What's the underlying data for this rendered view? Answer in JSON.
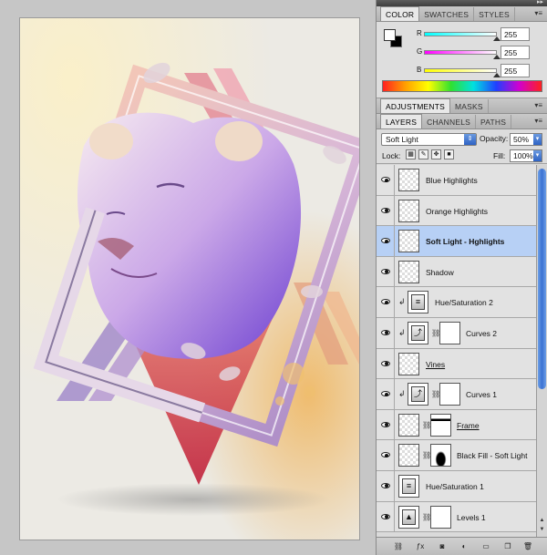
{
  "color_panel": {
    "tabs": [
      "COLOR",
      "SWATCHES",
      "STYLES"
    ],
    "active_tab": "COLOR",
    "channels": [
      {
        "label": "R",
        "value": "255"
      },
      {
        "label": "G",
        "value": "255"
      },
      {
        "label": "B",
        "value": "255"
      }
    ],
    "foreground_color": "#ffffff",
    "background_color": "#000000"
  },
  "adjustments_panel": {
    "tabs": [
      "ADJUSTMENTS",
      "MASKS"
    ]
  },
  "layers_panel": {
    "tabs": [
      "LAYERS",
      "CHANNELS",
      "PATHS"
    ],
    "blend_mode": "Soft Light",
    "opacity_label": "Opacity:",
    "opacity": "50%",
    "lock_label": "Lock:",
    "fill_label": "Fill:",
    "fill": "100%",
    "layers": [
      {
        "name": "Blue Highlights",
        "type": "pixel",
        "thumb": "blue",
        "visible": true,
        "selected": false,
        "clipped": false,
        "mask": false,
        "style": ""
      },
      {
        "name": "Orange Highlights",
        "type": "pixel",
        "thumb": "orange",
        "visible": true,
        "selected": false,
        "clipped": false,
        "mask": false,
        "style": ""
      },
      {
        "name": "Soft Light - Hghlights",
        "type": "pixel",
        "thumb": "empty",
        "visible": true,
        "selected": true,
        "clipped": false,
        "mask": false,
        "style": "bold"
      },
      {
        "name": "Shadow",
        "type": "pixel",
        "thumb": "empty",
        "visible": true,
        "selected": false,
        "clipped": false,
        "mask": false,
        "style": ""
      },
      {
        "name": "Hue/Saturation 2",
        "type": "adjustment",
        "thumb": "huesat",
        "visible": true,
        "selected": false,
        "clipped": true,
        "mask": false,
        "style": ""
      },
      {
        "name": "Curves 2",
        "type": "adjustment",
        "thumb": "curves",
        "visible": true,
        "selected": false,
        "clipped": true,
        "mask": true,
        "style": ""
      },
      {
        "name": "Vines",
        "type": "pixel",
        "thumb": "vines",
        "visible": true,
        "selected": false,
        "clipped": false,
        "mask": false,
        "style": "underline"
      },
      {
        "name": "Curves 1",
        "type": "adjustment",
        "thumb": "curves",
        "visible": true,
        "selected": false,
        "clipped": true,
        "mask": true,
        "style": ""
      },
      {
        "name": "Frame",
        "type": "pixel",
        "thumb": "frame",
        "visible": true,
        "selected": false,
        "clipped": false,
        "mask": true,
        "style": "underline"
      },
      {
        "name": "Black Fill - Soft Light",
        "type": "pixel",
        "thumb": "black",
        "visible": true,
        "selected": false,
        "clipped": false,
        "mask": true,
        "style": ""
      },
      {
        "name": "Hue/Saturation 1",
        "type": "adjustment",
        "thumb": "huesat",
        "visible": true,
        "selected": false,
        "clipped": false,
        "mask": false,
        "style": ""
      },
      {
        "name": "Levels 1",
        "type": "adjustment",
        "thumb": "levels",
        "visible": true,
        "selected": false,
        "clipped": false,
        "mask": true,
        "style": ""
      }
    ],
    "footer_icons": [
      "link-layers-icon",
      "fx-icon",
      "add-mask-icon",
      "adjustment-layer-icon",
      "group-icon",
      "new-layer-icon",
      "trash-icon"
    ]
  },
  "artwork": {
    "subject": "white lioness inside ornate frame",
    "palette": [
      "#f4d9a8",
      "#e8a0c0",
      "#8a5ad8",
      "#c8344a",
      "#f6efe6"
    ]
  }
}
